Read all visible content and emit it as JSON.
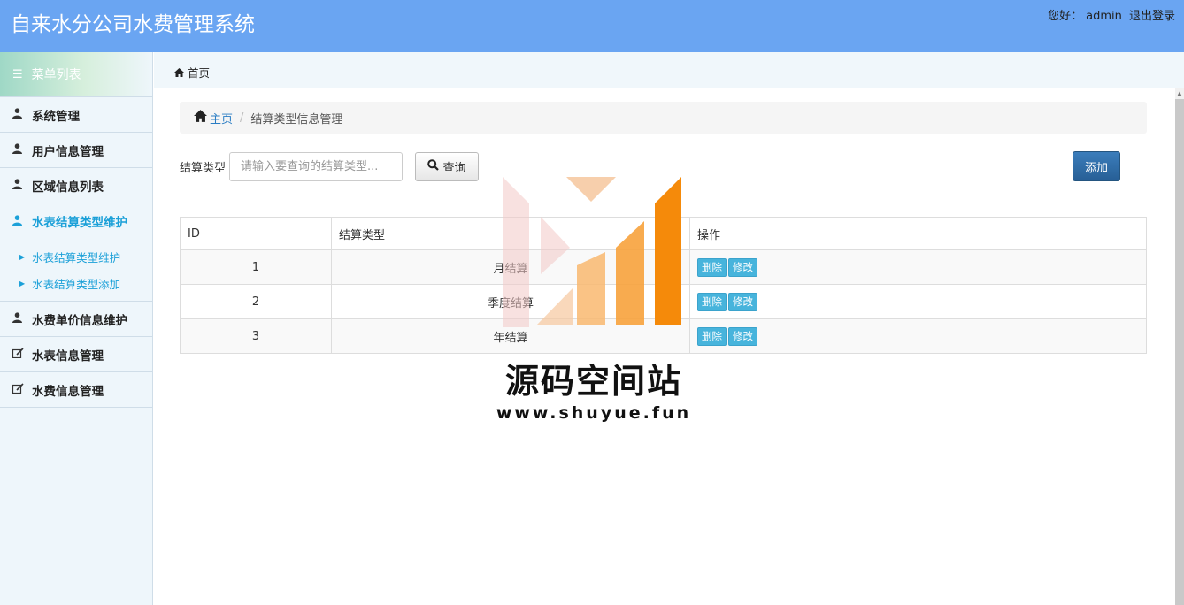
{
  "app": {
    "title": "自来水分公司水费管理系统"
  },
  "user": {
    "greeting": "您好：",
    "name": "admin",
    "logout": "退出登录"
  },
  "sidebar": {
    "header": "菜单列表",
    "items": [
      {
        "label": "系统管理",
        "icon": "user-icon"
      },
      {
        "label": "用户信息管理",
        "icon": "user-icon"
      },
      {
        "label": "区域信息列表",
        "icon": "user-icon"
      },
      {
        "label": "水表结算类型维护",
        "icon": "user-icon",
        "active": true,
        "children": [
          {
            "label": "水表结算类型维护"
          },
          {
            "label": "水表结算类型添加"
          }
        ]
      },
      {
        "label": "水费单价信息维护",
        "icon": "user-icon"
      },
      {
        "label": "水表信息管理",
        "icon": "edit-icon"
      },
      {
        "label": "水费信息管理",
        "icon": "edit-icon"
      }
    ]
  },
  "tabbar": {
    "home": "首页"
  },
  "breadcrumb": {
    "home": "主页",
    "current": "结算类型信息管理"
  },
  "search": {
    "label": "结算类型",
    "placeholder": "请输入要查询的结算类型...",
    "button": "查询"
  },
  "toolbar": {
    "add": "添加"
  },
  "table": {
    "headers": [
      "ID",
      "结算类型",
      "操作"
    ],
    "rows": [
      {
        "id": "1",
        "type": "月结算"
      },
      {
        "id": "2",
        "type": "季度结算"
      },
      {
        "id": "3",
        "type": "年结算"
      }
    ],
    "actions": {
      "delete": "删除",
      "edit": "修改"
    }
  },
  "watermark": {
    "name": "源码空间站",
    "url": "www.shuyue.fun"
  },
  "colors": {
    "topbar": "#6aa5f2",
    "accent": "#1ba0d8",
    "primary_button": "#2f6ea8",
    "mini_button": "#47b4dc"
  }
}
